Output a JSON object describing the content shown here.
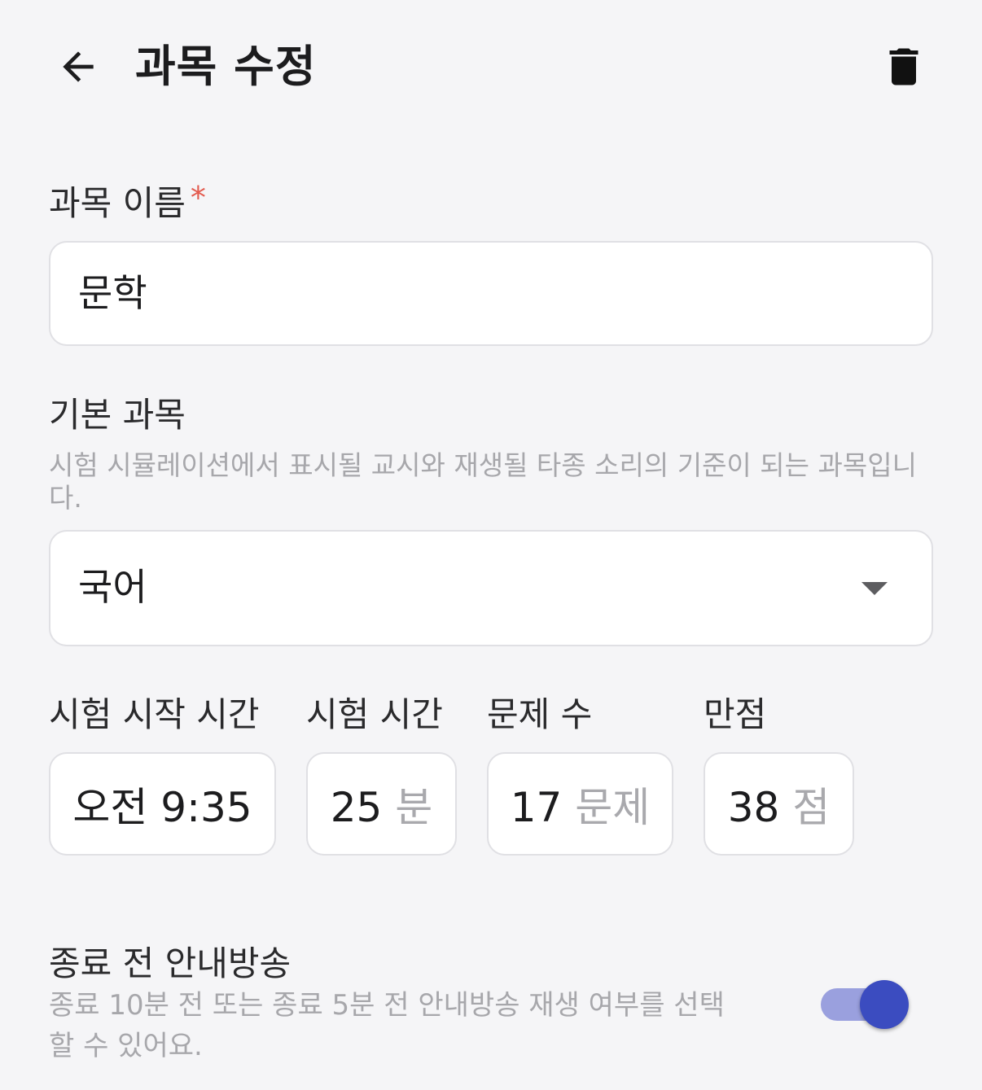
{
  "header": {
    "title": "과목 수정"
  },
  "icons": {
    "back": "arrow-left-icon",
    "delete": "trash-icon",
    "dropdown": "caret-down-icon"
  },
  "subject_name": {
    "label": "과목 이름",
    "required_mark": "*",
    "value": "문학"
  },
  "base_subject": {
    "label": "기본 과목",
    "helper": "시험 시뮬레이션에서 표시될 교시와 재생될 타종 소리의 기준이 되는 과목입니다.",
    "selected": "국어"
  },
  "exam": {
    "start_time": {
      "label": "시험 시작 시간",
      "value": "오전 9:35"
    },
    "duration": {
      "label": "시험 시간",
      "value": "25",
      "unit": "분"
    },
    "questions": {
      "label": "문제 수",
      "value": "17",
      "unit": "문제"
    },
    "full_score": {
      "label": "만점",
      "value": "38",
      "unit": "점"
    }
  },
  "announcement": {
    "label": "종료 전 안내방송",
    "helper": "종료 10분 전 또는 종료 5분 전 안내방송 재생 여부를 선택할 수 있어요.",
    "enabled": true
  },
  "colors": {
    "background": "#f5f5f7",
    "accent": "#3b4cc0",
    "accent_track": "#9aa0de",
    "required": "#e35a4e",
    "helper_text": "#a7a7ab"
  }
}
